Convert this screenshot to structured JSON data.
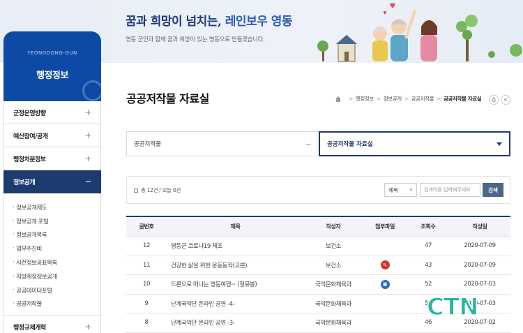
{
  "banner": {
    "slogan_part1": "꿈과 희망이 넘치는, ",
    "slogan_part2": "레인보우 영동",
    "sub_slogan": "영동 군민과 함께 꿈과 희망이 있는 영동으로 만들겠습니다."
  },
  "sidebar": {
    "english_name": "YEONGDONG-GUN",
    "title": "행정정보",
    "items": [
      {
        "label": "군정운영방향",
        "toggle": "+"
      },
      {
        "label": "예산참여/공개",
        "toggle": "+"
      },
      {
        "label": "행정처분정보",
        "toggle": "+"
      },
      {
        "label": "정보공개",
        "toggle": "−"
      }
    ],
    "subitems": [
      "정보공개제도",
      "정보공개 포털",
      "정보공개목록",
      "업무추진비",
      "사전정보공표목록",
      "지방재정정보공개",
      "공공데이터포털",
      "공공저작물"
    ],
    "next_item": {
      "label": "행정규제개혁",
      "toggle": "+"
    }
  },
  "page": {
    "title": "공공저작물 자료실",
    "breadcrumb": [
      "행정정보",
      "정보공개",
      "공공저작물",
      "공공저작물 자료실"
    ]
  },
  "selector": {
    "left": "공공저작물",
    "right": "공공저작물 자료실"
  },
  "search": {
    "count_text": "총 12건 / 오늘 0건",
    "type_selected": "제목",
    "placeholder": "검색어를 입력해주세요",
    "button": "검색"
  },
  "table": {
    "headers": [
      "글번호",
      "제목",
      "작성자",
      "첨부파일",
      "조회수",
      "작성일"
    ],
    "rows": [
      {
        "no": "12",
        "title": "영동군 코로나19 체조",
        "author": "보건소",
        "file": "",
        "views": "47",
        "date": "2020-07-09"
      },
      {
        "no": "11",
        "title": "건강한 삶을 위한 운동동작(교본)",
        "author": "보건소",
        "file": "pdf",
        "views": "43",
        "date": "2020-07-09"
      },
      {
        "no": "10",
        "title": "드론으로 떠나는 영동여행~ (힐뮤봉)",
        "author": "국악문화체육과",
        "file": "hwp",
        "views": "52",
        "date": "2020-07-03"
      },
      {
        "no": "9",
        "title": "난계국악단 온라인 공연 -4-",
        "author": "국악문화체육과",
        "file": "",
        "views": "53",
        "date": "2020-07-03"
      },
      {
        "no": "8",
        "title": "난계국악단 온라인 공연 -3-",
        "author": "국악문화체육과",
        "file": "",
        "views": "46",
        "date": "2020-07-02"
      }
    ]
  },
  "watermark": "CTN",
  "colors": {
    "navy": "#1d3b70",
    "blue": "#0d4aa6",
    "watermark": "#25b7a2"
  }
}
